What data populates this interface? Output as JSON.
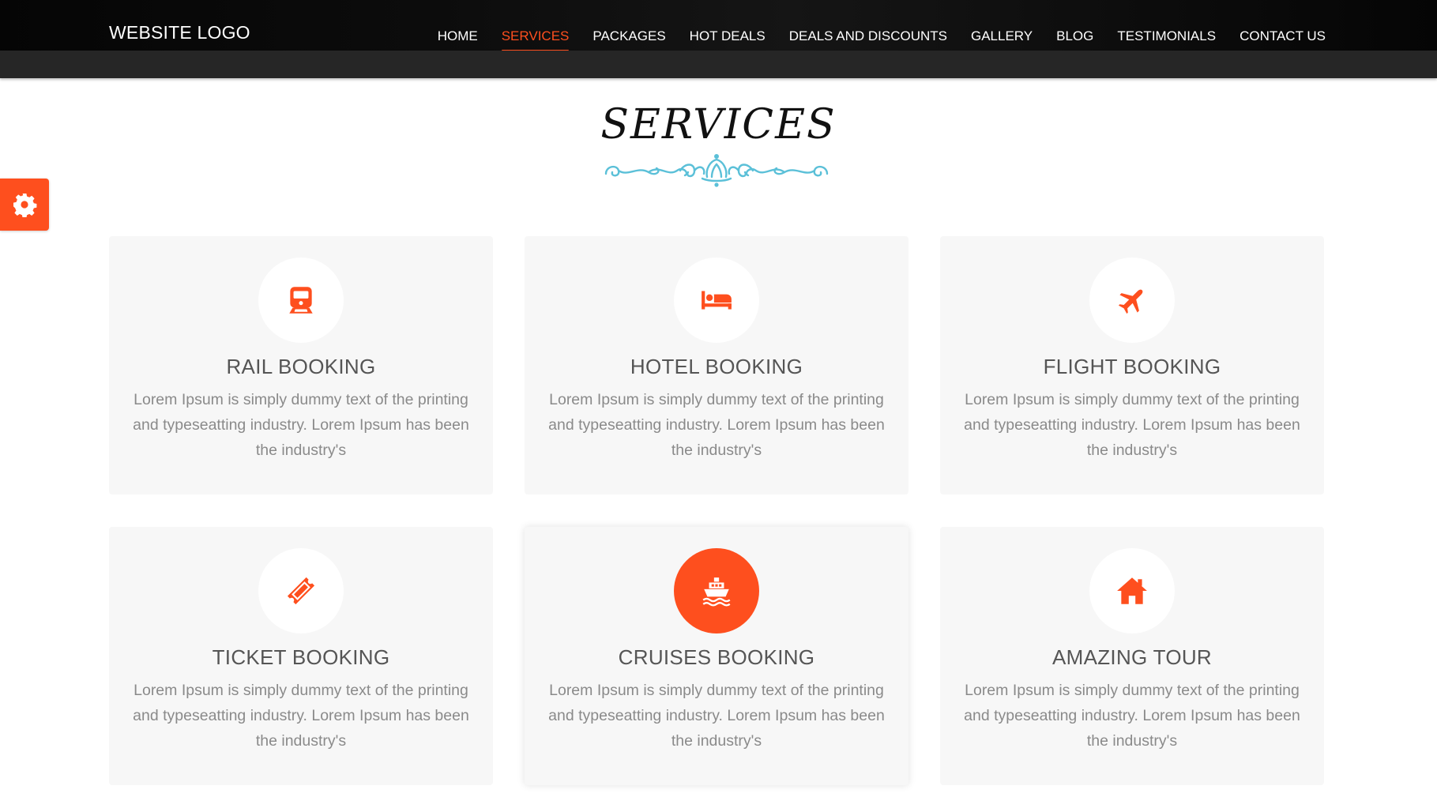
{
  "header": {
    "logo": "WEBSITE LOGO",
    "nav": [
      {
        "label": "HOME",
        "active": false
      },
      {
        "label": "SERVICES",
        "active": true
      },
      {
        "label": "PACKAGES",
        "active": false
      },
      {
        "label": "HOT DEALS",
        "active": false
      },
      {
        "label": "DEALS AND DISCOUNTS",
        "active": false
      },
      {
        "label": "GALLERY",
        "active": false
      },
      {
        "label": "BLOG",
        "active": false
      },
      {
        "label": "TESTIMONIALS",
        "active": false
      },
      {
        "label": "CONTACT US",
        "active": false
      }
    ]
  },
  "section": {
    "title": "SERVICES"
  },
  "settings": {
    "icon": "gear-icon"
  },
  "services": [
    {
      "title": "RAIL BOOKING",
      "icon": "train-icon",
      "description": "Lorem Ipsum is simply dummy text of the printing and typeseatting industry. Lorem Ipsum has been the industry's"
    },
    {
      "title": "HOTEL BOOKING",
      "icon": "bed-icon",
      "description": "Lorem Ipsum is simply dummy text of the printing and typeseatting industry. Lorem Ipsum has been the industry's"
    },
    {
      "title": "FLIGHT BOOKING",
      "icon": "plane-icon",
      "description": "Lorem Ipsum is simply dummy text of the printing and typeseatting industry. Lorem Ipsum has been the industry's"
    },
    {
      "title": "TICKET BOOKING",
      "icon": "ticket-icon",
      "description": "Lorem Ipsum is simply dummy text of the printing and typeseatting industry. Lorem Ipsum has been the industry's"
    },
    {
      "title": "CRUISES BOOKING",
      "icon": "ship-icon",
      "description": "Lorem Ipsum is simply dummy text of the printing and typeseatting industry. Lorem Ipsum has been the industry's"
    },
    {
      "title": "AMAZING TOUR",
      "icon": "home-icon",
      "description": "Lorem Ipsum is simply dummy text of the printing and typeseatting industry. Lorem Ipsum has been the industry's"
    }
  ],
  "colors": {
    "accent": "#fe4f1e",
    "ornament": "#5bc0d8",
    "card_bg": "#f7f7f7",
    "header_bg": "#0a0a0a"
  }
}
